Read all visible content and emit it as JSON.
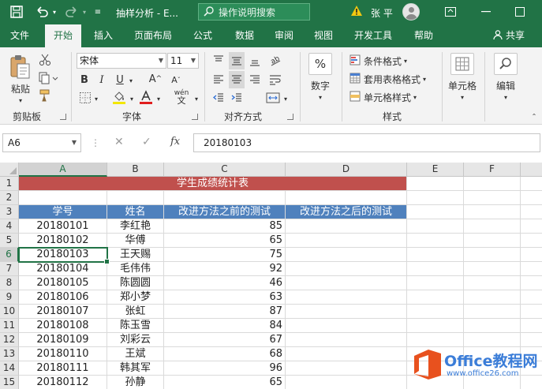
{
  "titlebar": {
    "filename": "抽样分析 - E...",
    "search_placeholder": "操作说明搜索",
    "user": "张 平"
  },
  "tabs": [
    "文件",
    "开始",
    "插入",
    "页面布局",
    "公式",
    "数据",
    "审阅",
    "视图",
    "开发工具",
    "帮助"
  ],
  "share": "共享",
  "ribbon": {
    "clipboard": {
      "paste": "粘贴",
      "label": "剪贴板"
    },
    "font": {
      "name": "宋体",
      "size": "11",
      "label": "字体",
      "bold": "B",
      "italic": "I",
      "underline": "U",
      "grow": "A",
      "shrink": "A",
      "wen": "wén"
    },
    "alignment": {
      "label": "对齐方式"
    },
    "number": {
      "symbol": "%",
      "label": "数字"
    },
    "styles": {
      "conditional": "条件格式",
      "table": "套用表格格式",
      "cell": "单元格样式",
      "label": "样式"
    },
    "cells": {
      "label": "单元格"
    },
    "editing": {
      "label": "编辑"
    }
  },
  "formula_bar": {
    "name_box": "A6",
    "fx": "fx",
    "content": "20180103"
  },
  "columns": [
    "A",
    "B",
    "C",
    "D",
    "E",
    "F"
  ],
  "rows": [
    "1",
    "2",
    "3",
    "4",
    "5",
    "6",
    "7",
    "8",
    "9",
    "10",
    "11",
    "12",
    "13",
    "14",
    "15"
  ],
  "sheet": {
    "title": "学生成绩统计表",
    "headers": [
      "学号",
      "姓名",
      "改进方法之前的测试",
      "改进方法之后的测试"
    ],
    "records": [
      {
        "id": "20180101",
        "name": "李红艳",
        "before": "85"
      },
      {
        "id": "20180102",
        "name": "华傅",
        "before": "65"
      },
      {
        "id": "20180103",
        "name": "王天赐",
        "before": "75"
      },
      {
        "id": "20180104",
        "name": "毛伟伟",
        "before": "92"
      },
      {
        "id": "20180105",
        "name": "陈圆圆",
        "before": "46"
      },
      {
        "id": "20180106",
        "name": "郑小梦",
        "before": "63"
      },
      {
        "id": "20180107",
        "name": "张虹",
        "before": "87"
      },
      {
        "id": "20180108",
        "name": "陈玉雪",
        "before": "84"
      },
      {
        "id": "20180109",
        "name": "刘彩云",
        "before": "67"
      },
      {
        "id": "20180110",
        "name": "王斌",
        "before": "68"
      },
      {
        "id": "20180111",
        "name": "韩其军",
        "before": "96"
      },
      {
        "id": "20180112",
        "name": "孙静",
        "before": "65"
      }
    ]
  },
  "watermark": {
    "brand": "Office教程网",
    "url": "www.office26.com"
  },
  "colors": {
    "excel_green": "#217346",
    "title_fill": "#c0504d",
    "header_fill": "#4f81bd",
    "font_red": "#e01e1e"
  }
}
